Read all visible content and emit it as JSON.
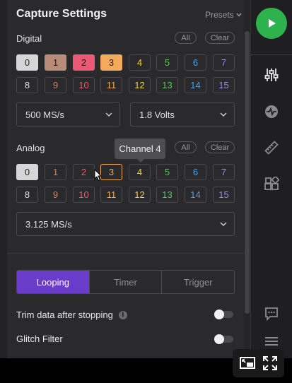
{
  "header": {
    "title": "Capture Settings",
    "presets_label": "Presets"
  },
  "digital": {
    "label": "Digital",
    "all_label": "All",
    "clear_label": "Clear",
    "channels": [
      {
        "n": "0",
        "color": "#222",
        "bg": "#d6d6d6",
        "border": "#d6d6d6"
      },
      {
        "n": "1",
        "color": "#2a1a10",
        "bg": "#b88c78",
        "border": "#b88c78"
      },
      {
        "n": "2",
        "color": "#2a0a12",
        "bg": "#ea5a74",
        "border": "#ea5a74"
      },
      {
        "n": "3",
        "color": "#2a1a00",
        "bg": "#f5a95a",
        "border": "#f5a95a"
      },
      {
        "n": "4",
        "color": "#f0d24a",
        "bg": "#2a2a2c",
        "border": "#48484d"
      },
      {
        "n": "5",
        "color": "#59c45e",
        "bg": "#2a2a2c",
        "border": "#48484d"
      },
      {
        "n": "6",
        "color": "#4aa0e8",
        "bg": "#2a2a2c",
        "border": "#48484d"
      },
      {
        "n": "7",
        "color": "#9a8ae8",
        "bg": "#2a2a2c",
        "border": "#48484d"
      },
      {
        "n": "8",
        "color": "#e0e0e0",
        "bg": "#2a2a2c",
        "border": "#48484d"
      },
      {
        "n": "9",
        "color": "#c8846a",
        "bg": "#2a2a2c",
        "border": "#48484d"
      },
      {
        "n": "10",
        "color": "#ea5a74",
        "bg": "#2a2a2c",
        "border": "#48484d"
      },
      {
        "n": "11",
        "color": "#f5a95a",
        "bg": "#2a2a2c",
        "border": "#48484d"
      },
      {
        "n": "12",
        "color": "#f0d24a",
        "bg": "#2a2a2c",
        "border": "#48484d"
      },
      {
        "n": "13",
        "color": "#59c45e",
        "bg": "#2a2a2c",
        "border": "#48484d"
      },
      {
        "n": "14",
        "color": "#4aa0e8",
        "bg": "#2a2a2c",
        "border": "#48484d"
      },
      {
        "n": "15",
        "color": "#9a8ae8",
        "bg": "#2a2a2c",
        "border": "#48484d"
      }
    ],
    "sample_rate": "500 MS/s",
    "voltage": "1.8 Volts"
  },
  "analog": {
    "label": "Analog",
    "all_label": "All",
    "clear_label": "Clear",
    "tooltip": "Channel 4",
    "channels": [
      {
        "n": "0",
        "color": "#222",
        "bg": "#d6d6d6",
        "border": "#d6d6d6"
      },
      {
        "n": "1",
        "color": "#c8846a",
        "bg": "#2a2a2c",
        "border": "#48484d"
      },
      {
        "n": "2",
        "color": "#ea5a74",
        "bg": "#2a2a2c",
        "border": "#48484d"
      },
      {
        "n": "3",
        "color": "#f5a95a",
        "bg": "#2a2a2c",
        "border": "#f5a95a"
      },
      {
        "n": "4",
        "color": "#f0d24a",
        "bg": "#2a2a2c",
        "border": "#48484d"
      },
      {
        "n": "5",
        "color": "#59c45e",
        "bg": "#2a2a2c",
        "border": "#48484d"
      },
      {
        "n": "6",
        "color": "#4aa0e8",
        "bg": "#2a2a2c",
        "border": "#48484d"
      },
      {
        "n": "7",
        "color": "#9a8ae8",
        "bg": "#2a2a2c",
        "border": "#48484d"
      },
      {
        "n": "8",
        "color": "#e0e0e0",
        "bg": "#2a2a2c",
        "border": "#48484d"
      },
      {
        "n": "9",
        "color": "#c8846a",
        "bg": "#2a2a2c",
        "border": "#48484d"
      },
      {
        "n": "10",
        "color": "#ea5a74",
        "bg": "#2a2a2c",
        "border": "#48484d"
      },
      {
        "n": "11",
        "color": "#f5a95a",
        "bg": "#2a2a2c",
        "border": "#48484d"
      },
      {
        "n": "12",
        "color": "#f0d24a",
        "bg": "#2a2a2c",
        "border": "#48484d"
      },
      {
        "n": "13",
        "color": "#59c45e",
        "bg": "#2a2a2c",
        "border": "#48484d"
      },
      {
        "n": "14",
        "color": "#4aa0e8",
        "bg": "#2a2a2c",
        "border": "#48484d"
      },
      {
        "n": "15",
        "color": "#9a8ae8",
        "bg": "#2a2a2c",
        "border": "#48484d"
      }
    ],
    "sample_rate": "3.125 MS/s"
  },
  "mode_tabs": [
    {
      "label": "Looping",
      "active": true
    },
    {
      "label": "Timer",
      "active": false
    },
    {
      "label": "Trigger",
      "active": false
    }
  ],
  "options": {
    "trim_label": "Trim data after stopping",
    "trim_enabled": false,
    "glitch_label": "Glitch Filter",
    "glitch_enabled": false
  },
  "sidebar": {
    "icons": [
      "play-icon",
      "sliders-icon",
      "analyzer-icon",
      "ruler-icon",
      "extensions-icon",
      "chat-icon",
      "menu-icon"
    ]
  },
  "colors": {
    "accent": "#6a3cc9",
    "run": "#2db24d"
  }
}
